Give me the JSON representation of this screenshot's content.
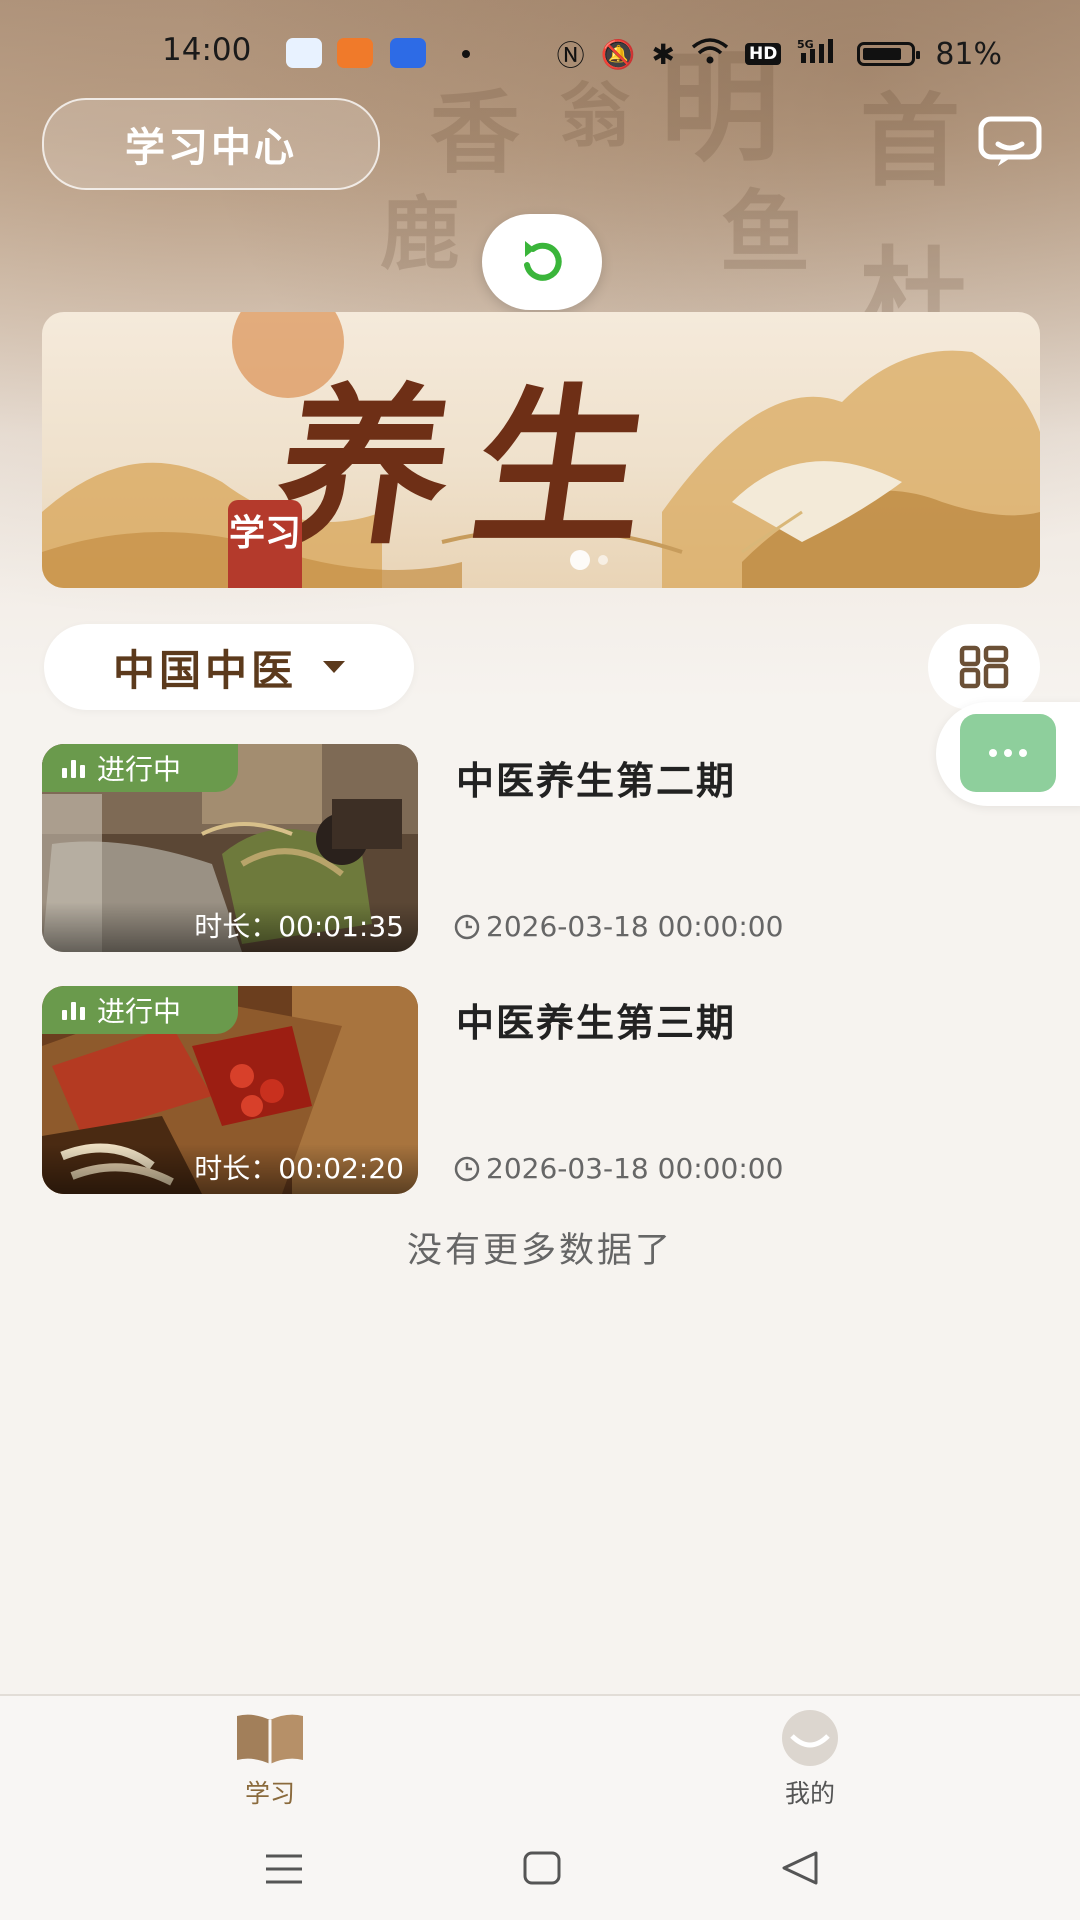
{
  "status_bar": {
    "time": "14:00",
    "battery": "81%",
    "icons": [
      "nfc-icon",
      "mute-icon",
      "bluetooth-icon",
      "wifi-icon",
      "hd-icon",
      "signal-5g-icon"
    ]
  },
  "header": {
    "title": "学习中心",
    "message_icon": "chat-bubble-icon",
    "refresh_icon": "refresh-icon"
  },
  "banner": {
    "title": "养生",
    "seal_text": "学习"
  },
  "filter": {
    "category": "中国中医",
    "grid_icon": "grid-layout-icon",
    "more_icon": "more-dots-icon"
  },
  "courses": [
    {
      "title": "中医养生第二期",
      "status": "进行中",
      "duration": "时长：00:01:35",
      "date": "2026-03-18 00:00:00"
    },
    {
      "title": "中医养生第三期",
      "status": "进行中",
      "duration": "时长：00:02:20",
      "date": "2026-03-18 00:00:00"
    }
  ],
  "list_end_text": "没有更多数据了",
  "tabs": [
    {
      "label": "学习",
      "icon": "book-icon",
      "active": true
    },
    {
      "label": "我的",
      "icon": "profile-icon",
      "active": false
    }
  ],
  "colors": {
    "accent_brown": "#5c3a1c",
    "tab_active": "#8a6a3c",
    "tag_green": "#6a9a4c",
    "float_green": "#8ecf9c",
    "refresh_green": "#3ab53a"
  }
}
